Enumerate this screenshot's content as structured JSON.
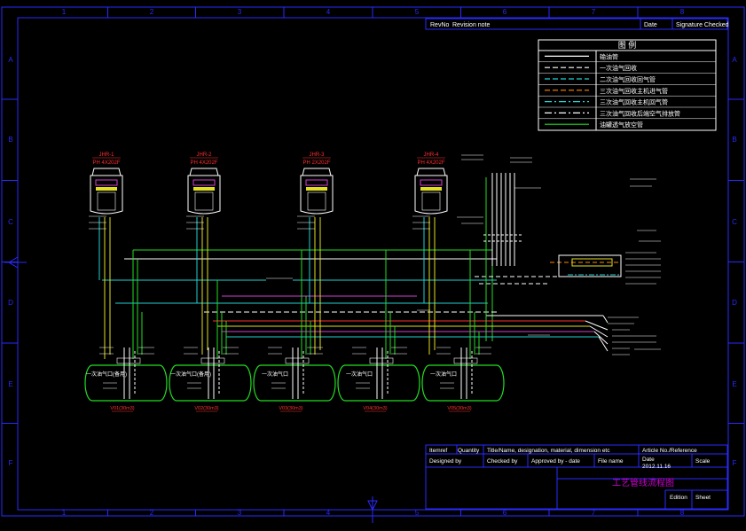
{
  "colors": {
    "frame": "#2a2aff",
    "white": "#ffffff",
    "red": "#ff3030",
    "green": "#22dd22",
    "cyan": "#22d0d0",
    "yellow": "#e0e020",
    "magenta": "#d040d0",
    "purple_title": "#d000d0",
    "orange": "#ff8800"
  },
  "grid": {
    "columns": [
      "1",
      "2",
      "3",
      "4",
      "5",
      "6",
      "7",
      "8"
    ],
    "rows": [
      "A",
      "B",
      "C",
      "D",
      "E",
      "F"
    ]
  },
  "revision_block": {
    "rev_no": "RevNo",
    "revision_note": "Revision note",
    "date": "Date",
    "signature_checked": "Signature Checked"
  },
  "legend": {
    "title": "图    例",
    "items": [
      {
        "label": "输油管",
        "color": "#ffffff",
        "dash": "solid"
      },
      {
        "label": "一次油气回收",
        "color": "#ffffff",
        "dash": "dash"
      },
      {
        "label": "二次油气回收回气管",
        "color": "#22d0d0",
        "dash": "dash"
      },
      {
        "label": "三次油气回收主机进气管",
        "color": "#ff8800",
        "dash": "dash"
      },
      {
        "label": "三次油气回收主机回气管",
        "color": "#22d0d0",
        "dash": "dashdot"
      },
      {
        "label": "三次油气回收后端空气排放管",
        "color": "#ffffff",
        "dash": "dashdot"
      },
      {
        "label": "油罐透气放空管",
        "color": "#22dd22",
        "dash": "solid"
      }
    ]
  },
  "dispensers": [
    {
      "name": "JHR-1",
      "model": "PH 4X202F"
    },
    {
      "name": "JHR-2",
      "model": "PH 4X202F"
    },
    {
      "name": "JHR-3",
      "model": "PH 2X202F"
    },
    {
      "name": "JHR-4",
      "model": "PH 4X202F"
    }
  ],
  "tanks": [
    {
      "label": "一次油气口(备用)",
      "tag": "V01(30m3)"
    },
    {
      "label": "一次油气口(备用)",
      "tag": "V02(30m3)"
    },
    {
      "label": "一次油气口",
      "tag": "V03(30m3)"
    },
    {
      "label": "一次油气口",
      "tag": "V04(30m3)"
    },
    {
      "label": "一次油气口",
      "tag": "V05(30m3)"
    }
  ],
  "title_block": {
    "item_ref": "Itemref",
    "quantity": "Quantity",
    "title_name": "Title/Name, designation, material, dimension etc",
    "article_no": "Article No./Reference",
    "designed_by": "Designed by",
    "checked_by": "Checked by",
    "approved_by": "Approved by - date",
    "file_name": "File name",
    "date_label": "Date",
    "date_value": "2012.11.16",
    "scale": "Scale",
    "drawing_title": "工艺管线流程图",
    "edition": "Edition",
    "sheet": "Sheet"
  }
}
